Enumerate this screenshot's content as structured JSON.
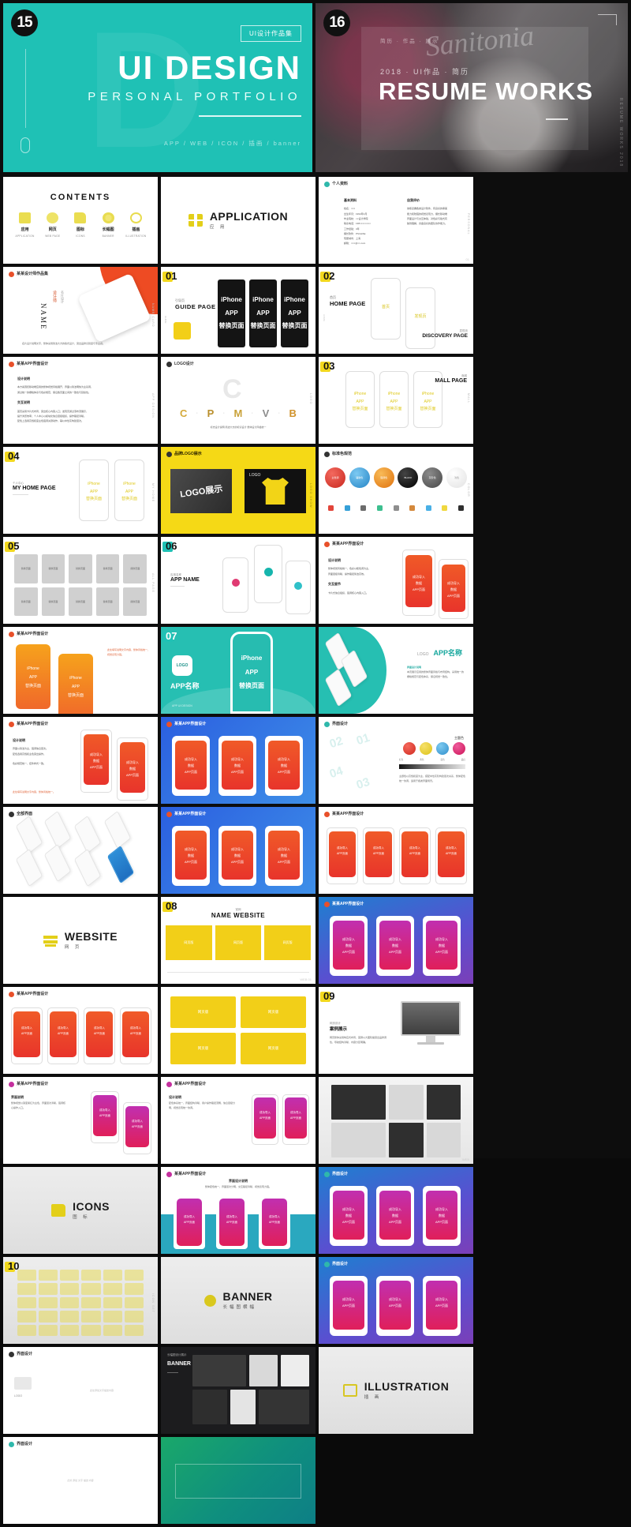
{
  "hero": {
    "slide15": {
      "number": "15",
      "tag": "UI设计作品集",
      "title": "UI DESIGN",
      "subtitle": "PERSONAL PORTFOLIO",
      "keywords": "APP  /  WEB  /  ICON  /  插画  /  banner",
      "ghost_letter": "D"
    },
    "slide16": {
      "number": "16",
      "micro": "简历 · 作品 · 展示",
      "eyebrow": "2018 · UI作品 · 简历",
      "title": "RESUME WORKS",
      "script": "Sanitonia",
      "side": "RESUME WORKS 2018"
    }
  },
  "contents": {
    "title": "CONTENTS",
    "items": [
      {
        "cn": "应用",
        "en": "APPLICATION"
      },
      {
        "cn": "网页",
        "en": "WEB PAGE"
      },
      {
        "cn": "图标",
        "en": "ICONS"
      },
      {
        "cn": "长幅图",
        "en": "BANNER"
      },
      {
        "cn": "插画",
        "en": "ILLUSTRATION"
      }
    ]
  },
  "sections": [
    {
      "en": "APPLICATION",
      "cn": "应 用",
      "icon": "grid-squares-icon"
    },
    {
      "en": "WEBSITE",
      "cn": "网 页",
      "icon": "stack-lines-icon"
    },
    {
      "en": "ICONS",
      "cn": "图 标",
      "icon": "folder-icon"
    },
    {
      "en": "BANNER",
      "cn": "长幅图横幅",
      "icon": "circle-icon"
    },
    {
      "en": "ILLUSTRATION",
      "cn": "插 画",
      "icon": "picture-frame-icon"
    }
  ],
  "numbered": {
    "s01": {
      "no": "01",
      "cn": "引导页",
      "en": "GUIDE PAGE"
    },
    "s02": {
      "no": "02",
      "cn": "首页",
      "en": "HOME PAGE",
      "cn2": "发现页",
      "en2": "DISCOVERY PAGE"
    },
    "s03": {
      "no": "03",
      "cn": "商城",
      "en": "MALL PAGE"
    },
    "s04": {
      "no": "04",
      "cn": "个人中心",
      "en": "MY HOME PAGE"
    },
    "s05": {
      "no": "05"
    },
    "s06": {
      "no": "06",
      "cn": "应用名称",
      "en": "APP NAME"
    },
    "s07": {
      "no": "07",
      "logo": "LOGO",
      "appname": "APP名称"
    },
    "s08": {
      "no": "08",
      "cn": "官网",
      "en": "NAME WEBSITE"
    },
    "s09": {
      "no": "09",
      "cn": "网页设计",
      "en": "案例展示"
    },
    "s10": {
      "no": "10"
    }
  },
  "phone_mock": {
    "line1": "iPhone",
    "line2": "APP",
    "line3": "替换页面"
  },
  "logo_slide": {
    "header": "LOGO设计",
    "letters": [
      "C",
      "P",
      "M",
      "V",
      "B"
    ],
    "caption": "标志设计说明 简洁大方的标识设计 整体设计风格统一"
  },
  "logo_show": {
    "header": "品牌LOGO展示",
    "big_label": "LOGO展示",
    "small_label": "LOGO"
  },
  "palette": {
    "header": "标准色规范",
    "swatches": [
      {
        "hex": "#e23b34",
        "label": "主色调"
      },
      {
        "hex": "#3aa4e0",
        "label": "辅助色"
      },
      {
        "hex": "#f08f22",
        "label": "强调色"
      },
      {
        "hex": "#141414",
        "label": "BLACK"
      },
      {
        "hex": "#5d5d5d",
        "label": "灰阶色"
      },
      {
        "hex": "#f2f2f2",
        "label": "浅色"
      }
    ]
  },
  "ui_design_slide": {
    "header": "界面设计",
    "label": "主题色",
    "numbers": [
      "01",
      "02",
      "03",
      "04"
    ],
    "colors": [
      {
        "hex": "#e4452f",
        "label": "红色"
      },
      {
        "hex": "#f0cf26",
        "label": "黄色"
      },
      {
        "hex": "#3ba6e5",
        "label": "蓝色"
      },
      {
        "hex": "#e0246e",
        "label": "品红"
      }
    ]
  },
  "isometric": {
    "header": "全部界面"
  },
  "profile": {
    "header": "个人资料",
    "col1_title": "基本资料",
    "col2_title": "自我评价"
  },
  "namecard": {
    "header": "某某设计师作品集",
    "name": "NAME",
    "title_cn": "设计师",
    "sub_cn": "名片设计"
  },
  "app_slides": {
    "header_red": "某某APP界面设计",
    "header_teal": "界面设计",
    "screen_lines": [
      "成功导入",
      "数据",
      "APP页面"
    ]
  },
  "website_slide": {
    "header": "界面设计",
    "heading_cn": "网页版",
    "heading_en": "HOME"
  },
  "accent_colors": {
    "teal": "#1fc1b5",
    "yellow": "#f2d81e",
    "orange": "#e8502a",
    "magenta": "#d6218f",
    "blue": "#2b5fe0"
  }
}
